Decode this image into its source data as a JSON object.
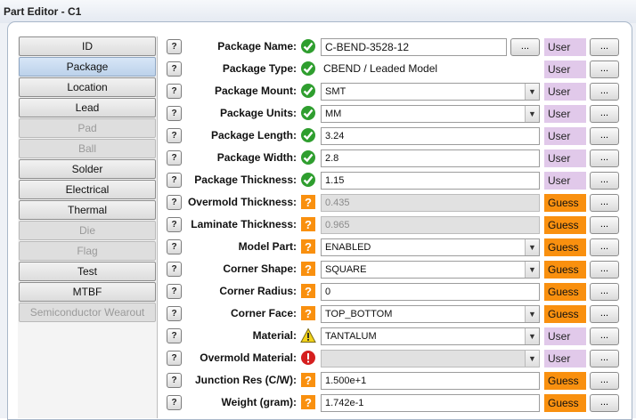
{
  "window": {
    "title": "Part Editor - C1"
  },
  "tabs": [
    {
      "label": "ID",
      "state": "normal"
    },
    {
      "label": "Package",
      "state": "active"
    },
    {
      "label": "Location",
      "state": "normal"
    },
    {
      "label": "Lead",
      "state": "normal"
    },
    {
      "label": "Pad",
      "state": "disabled"
    },
    {
      "label": "Ball",
      "state": "disabled"
    },
    {
      "label": "Solder",
      "state": "normal"
    },
    {
      "label": "Electrical",
      "state": "normal"
    },
    {
      "label": "Thermal",
      "state": "normal"
    },
    {
      "label": "Die",
      "state": "disabled"
    },
    {
      "label": "Flag",
      "state": "disabled"
    },
    {
      "label": "Test",
      "state": "normal"
    },
    {
      "label": "MTBF",
      "state": "normal"
    },
    {
      "label": "Semiconductor Wearout",
      "state": "disabled"
    }
  ],
  "help_label": "?",
  "more_label": "...",
  "status_colors": {
    "ok": "#2f9e2f",
    "guess": "#f9900f",
    "warning": "#f2d21b",
    "error": "#d51f1f",
    "user": "#e1c9ea"
  },
  "rows": [
    {
      "label": "Package Name:",
      "status": "ok",
      "kind": "name",
      "value": "C-BEND-3528-12",
      "source": "User"
    },
    {
      "label": "Package Type:",
      "status": "ok",
      "kind": "plain",
      "value": "CBEND / Leaded Model",
      "source": "User"
    },
    {
      "label": "Package Mount:",
      "status": "ok",
      "kind": "select",
      "value": "SMT",
      "source": "User"
    },
    {
      "label": "Package Units:",
      "status": "ok",
      "kind": "select",
      "value": "MM",
      "source": "User"
    },
    {
      "label": "Package Length:",
      "status": "ok",
      "kind": "input",
      "value": "3.24",
      "source": "User"
    },
    {
      "label": "Package Width:",
      "status": "ok",
      "kind": "input",
      "value": "2.8",
      "source": "User"
    },
    {
      "label": "Package Thickness:",
      "status": "ok",
      "kind": "input",
      "value": "1.15",
      "source": "User"
    },
    {
      "label": "Overmold Thickness:",
      "status": "guess",
      "kind": "disabled",
      "value": "0.435",
      "source": "Guess"
    },
    {
      "label": "Laminate Thickness:",
      "status": "guess",
      "kind": "disabled",
      "value": "0.965",
      "source": "Guess"
    },
    {
      "label": "Model Part:",
      "status": "guess",
      "kind": "select",
      "value": "ENABLED",
      "source": "Guess"
    },
    {
      "label": "Corner Shape:",
      "status": "guess",
      "kind": "select",
      "value": "SQUARE",
      "source": "Guess"
    },
    {
      "label": "Corner Radius:",
      "status": "guess",
      "kind": "input",
      "value": "0",
      "source": "Guess"
    },
    {
      "label": "Corner Face:",
      "status": "guess",
      "kind": "select",
      "value": "TOP_BOTTOM",
      "source": "Guess"
    },
    {
      "label": "Material:",
      "status": "warning",
      "kind": "select",
      "value": "TANTALUM",
      "source": "User"
    },
    {
      "label": "Overmold Material:",
      "status": "error",
      "kind": "disabled-select",
      "value": "",
      "source": "User"
    },
    {
      "label": "Junction Res (C/W):",
      "status": "guess",
      "kind": "input",
      "value": "1.500e+1",
      "source": "Guess"
    },
    {
      "label": "Weight (gram):",
      "status": "guess",
      "kind": "input",
      "value": "1.742e-1",
      "source": "Guess"
    }
  ]
}
